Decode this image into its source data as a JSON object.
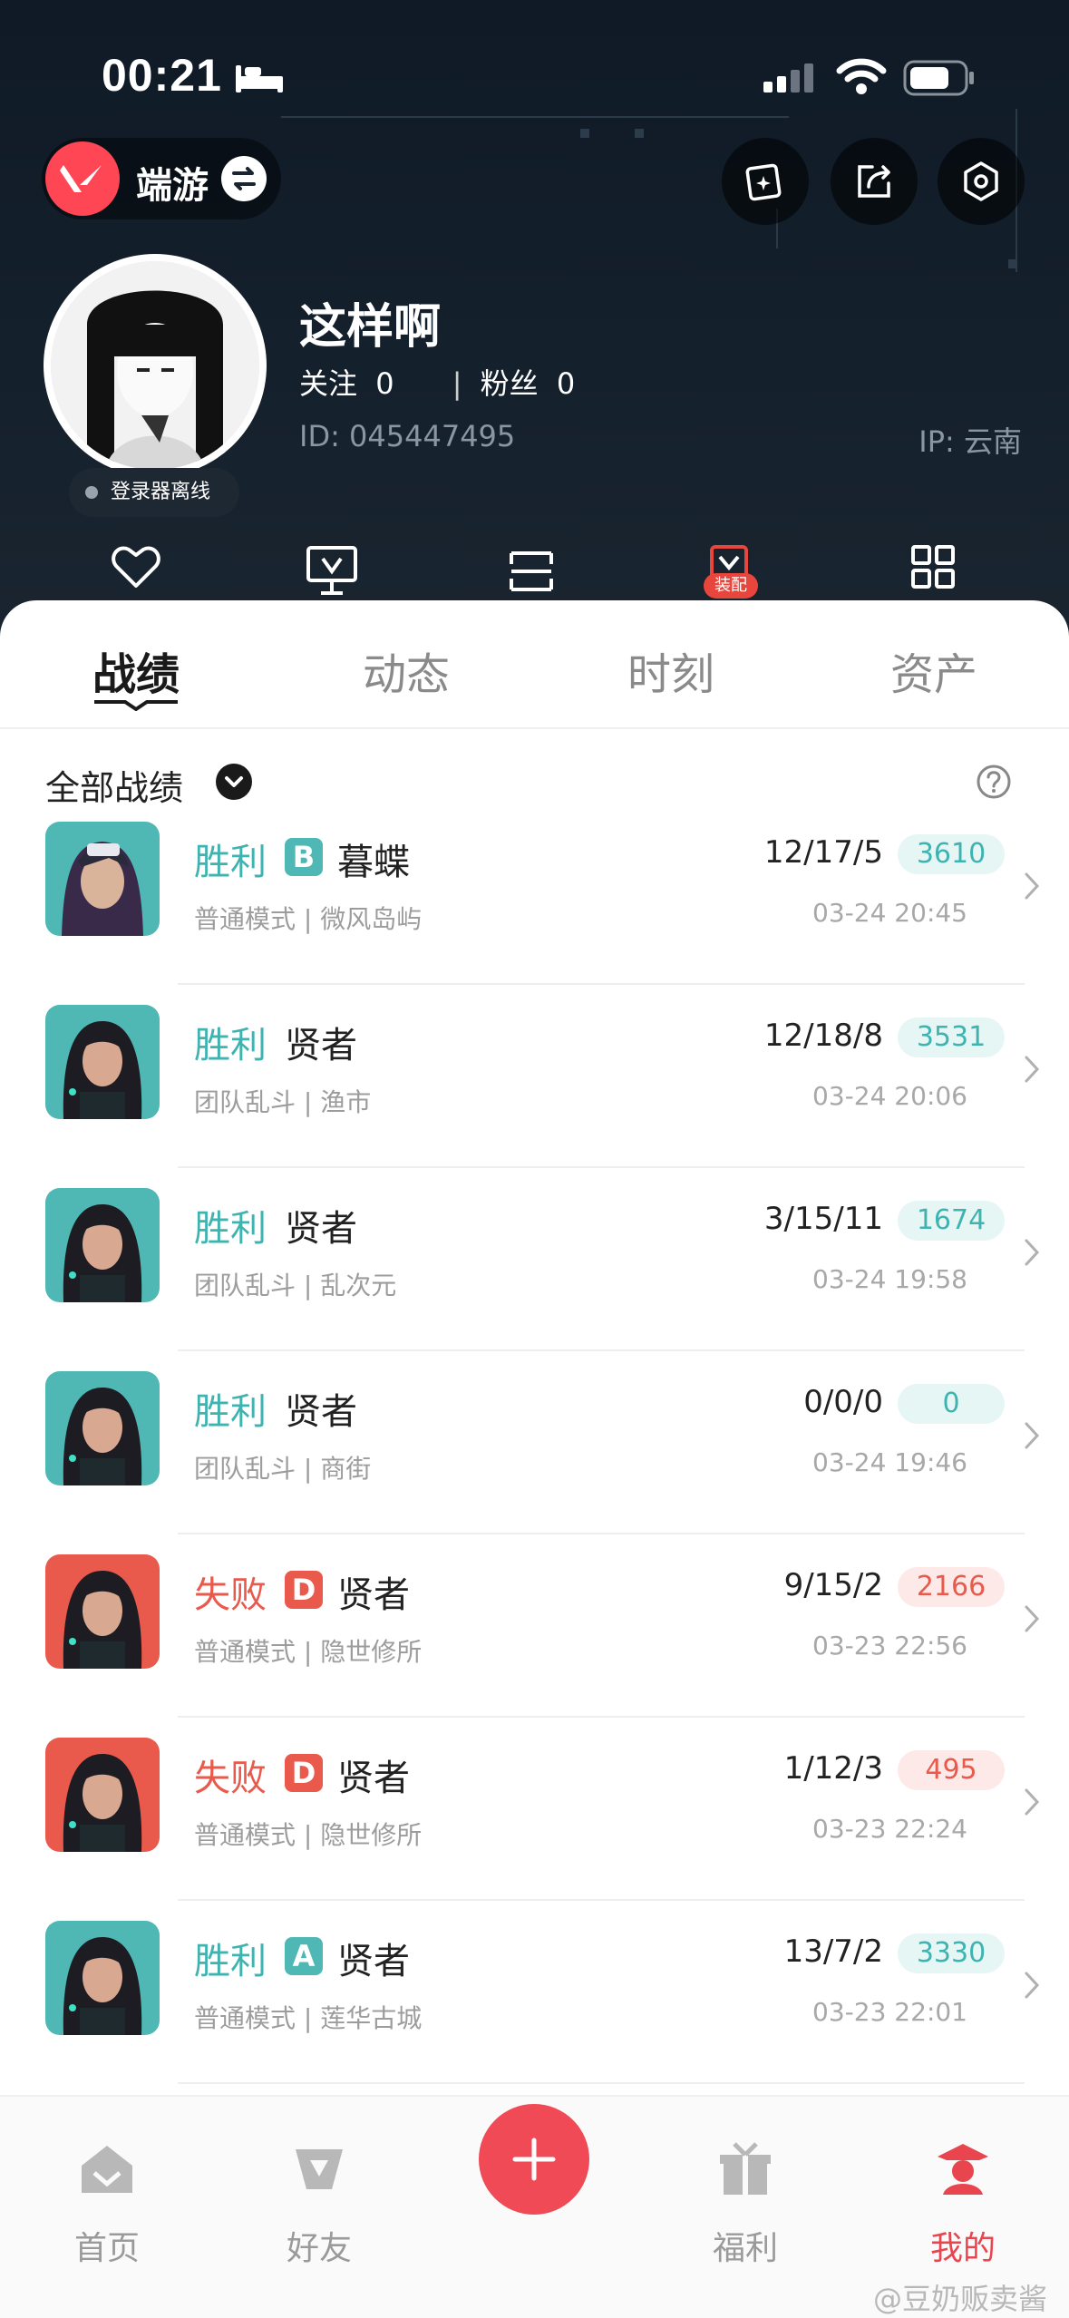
{
  "status_bar": {
    "time": "00:21"
  },
  "header": {
    "game_name": "端游",
    "username": "这样啊",
    "following_label": "关注",
    "following_count": "0",
    "fans_label": "粉丝",
    "fans_count": "0",
    "user_id": "ID: 045447495",
    "ip_location": "IP: 云南",
    "login_status": "登录器离线",
    "equip_badge": "装配"
  },
  "tabs": [
    {
      "label": "战绩"
    },
    {
      "label": "动态"
    },
    {
      "label": "时刻"
    },
    {
      "label": "资产"
    }
  ],
  "filter": {
    "label": "全部战绩"
  },
  "matches": [
    {
      "result": "胜利",
      "outcome": "win",
      "grade": "B",
      "agent": "暮蝶",
      "mode": "普通模式 | 微风岛屿",
      "kda": "12/17/5",
      "score": "3610",
      "time": "03-24 20:45",
      "thumb": "agent-clove"
    },
    {
      "result": "胜利",
      "outcome": "win",
      "grade": "",
      "agent": "贤者",
      "mode": "团队乱斗 | 渔市",
      "kda": "12/18/8",
      "score": "3531",
      "time": "03-24 20:06",
      "thumb": "agent-sage"
    },
    {
      "result": "胜利",
      "outcome": "win",
      "grade": "",
      "agent": "贤者",
      "mode": "团队乱斗 | 乱次元",
      "kda": "3/15/11",
      "score": "1674",
      "time": "03-24 19:58",
      "thumb": "agent-sage"
    },
    {
      "result": "胜利",
      "outcome": "win",
      "grade": "",
      "agent": "贤者",
      "mode": "团队乱斗 | 商街",
      "kda": "0/0/0",
      "score": "0",
      "time": "03-24 19:46",
      "thumb": "agent-sage"
    },
    {
      "result": "失败",
      "outcome": "loss",
      "grade": "D",
      "agent": "贤者",
      "mode": "普通模式 | 隐世修所",
      "kda": "9/15/2",
      "score": "2166",
      "time": "03-23 22:56",
      "thumb": "agent-sage"
    },
    {
      "result": "失败",
      "outcome": "loss",
      "grade": "D",
      "agent": "贤者",
      "mode": "普通模式 | 隐世修所",
      "kda": "1/12/3",
      "score": "495",
      "time": "03-23 22:24",
      "thumb": "agent-sage"
    },
    {
      "result": "胜利",
      "outcome": "win",
      "grade": "A",
      "agent": "贤者",
      "mode": "普通模式 | 莲华古城",
      "kda": "13/7/2",
      "score": "3330",
      "time": "03-23 22:01",
      "thumb": "agent-sage"
    }
  ],
  "bottom_nav": [
    {
      "label": "首页",
      "icon": "home-icon"
    },
    {
      "label": "好友",
      "icon": "friends-icon"
    },
    {
      "label": "福利",
      "icon": "gift-icon"
    },
    {
      "label": "我的",
      "icon": "profile-icon"
    }
  ],
  "watermark": "@豆奶贩卖酱",
  "colors": {
    "win": "#3eb3b0",
    "loss": "#ea5a4c",
    "grade_b": "#4fb8b4",
    "grade_a": "#4fb8b4",
    "grade_d": "#ea5a4c",
    "accent": "#ef4a55"
  }
}
